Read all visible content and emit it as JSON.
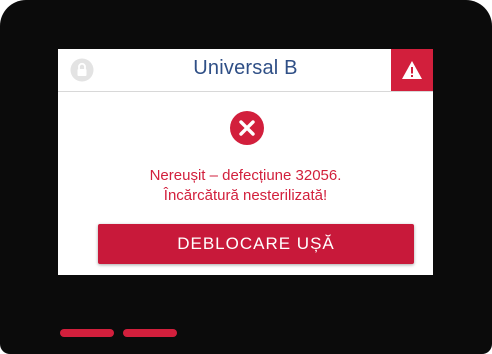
{
  "header": {
    "title": "Universal B",
    "lock_icon": "lock-icon",
    "warning_icon": "warning-triangle-icon"
  },
  "status": {
    "icon": "error-x-circle-icon",
    "line1": "Nereușit – defecțiune 32056.",
    "line2": "Încărcătură nesterilizată!"
  },
  "actions": {
    "unlock_door_label": "DEBLOCARE UȘĂ"
  },
  "colors": {
    "accent_red": "#d21f3c",
    "title_blue": "#2f4f86",
    "bezel": "#0b0b0b"
  }
}
